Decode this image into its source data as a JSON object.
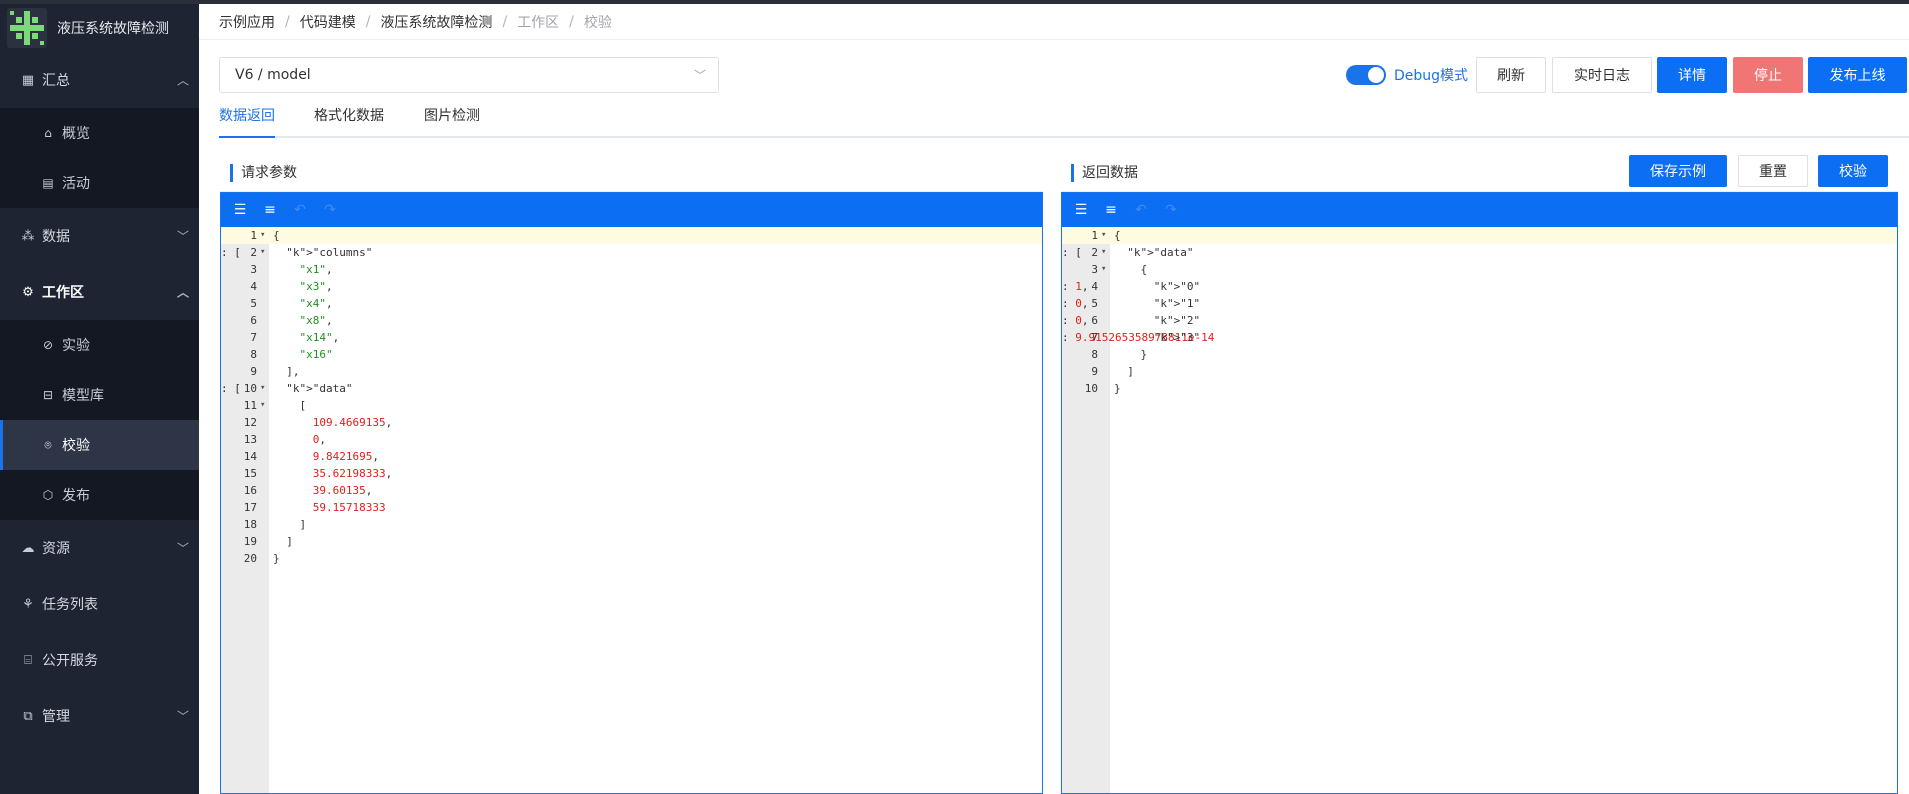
{
  "app": {
    "title": "液压系统故障检测"
  },
  "sidebar": {
    "groups": [
      {
        "label": "汇总",
        "icon": "dashboard-icon",
        "expanded": true,
        "items": [
          {
            "label": "概览",
            "icon": "home-icon"
          },
          {
            "label": "活动",
            "icon": "calendar-icon"
          }
        ]
      },
      {
        "label": "数据",
        "icon": "data-icon",
        "expanded": false,
        "items": []
      },
      {
        "label": "工作区",
        "icon": "gear-icon",
        "expanded": true,
        "items": [
          {
            "label": "实验",
            "icon": "experiment-icon"
          },
          {
            "label": "模型库",
            "icon": "model-library-icon"
          },
          {
            "label": "校验",
            "icon": "check-scan-icon",
            "active": true
          },
          {
            "label": "发布",
            "icon": "box-icon"
          }
        ]
      },
      {
        "label": "资源",
        "icon": "cloud-icon",
        "expanded": false,
        "items": []
      },
      {
        "label": "任务列表",
        "icon": "task-icon"
      },
      {
        "label": "公开服务",
        "icon": "store-icon"
      },
      {
        "label": "管理",
        "icon": "manage-icon",
        "expanded": false
      }
    ]
  },
  "breadcrumb": [
    "示例应用",
    "代码建模",
    "液压系统故障检测",
    "工作区",
    "校验"
  ],
  "toolbar": {
    "model_select": "V6 / model",
    "debug_label": "Debug模式",
    "debug_on": true,
    "refresh": "刷新",
    "realtime_log": "实时日志",
    "details": "详情",
    "stop": "停止",
    "publish": "发布上线"
  },
  "tabs": [
    "数据返回",
    "格式化数据",
    "图片检测"
  ],
  "request_panel": {
    "title": "请求参数",
    "lines": [
      "{",
      "  \"columns\": [",
      "    \"x1\",",
      "    \"x3\",",
      "    \"x4\",",
      "    \"x8\",",
      "    \"x14\",",
      "    \"x16\"",
      "  ],",
      "  \"data\": [",
      "    [",
      "      109.4669135,",
      "      0,",
      "      9.8421695,",
      "      35.62198333,",
      "      39.60135,",
      "      59.15718333",
      "    ]",
      "  ]",
      "}"
    ]
  },
  "response_panel": {
    "title": "返回数据",
    "save_example": "保存示例",
    "reset": "重置",
    "verify": "校验",
    "lines": [
      "{",
      "  \"data\": [",
      "    {",
      "      \"0\": 1,",
      "      \"1\": 0,",
      "      \"2\": 0,",
      "      \"3\": 9.915265358978811e-14",
      "    }",
      "  ]",
      "}"
    ]
  },
  "colors": {
    "primary": "#0b6ef3",
    "danger": "#f07676",
    "sidebar_bg": "#1f2432",
    "string": "#1f8f1f",
    "number": "#e0201c"
  }
}
